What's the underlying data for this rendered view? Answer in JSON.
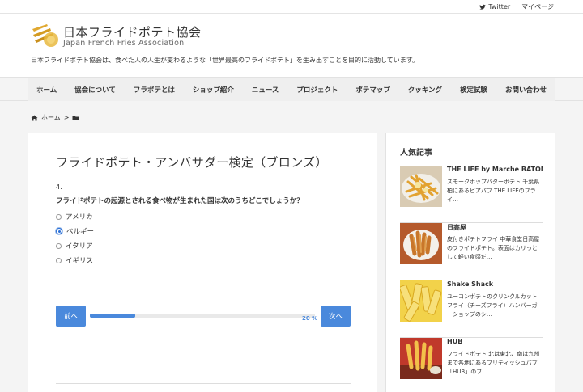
{
  "topbar": {
    "twitter": "Twitter",
    "mypage": "マイページ"
  },
  "header": {
    "logo_title": "日本フライドポテト協会",
    "logo_sub": "Japan French Fries Association",
    "tagline": "日本フライドポテト協会は、食べた人の人生が変わるような「世界最高のフライドポテト」を生み出すことを目的に活動しています。"
  },
  "nav": [
    "ホーム",
    "協会について",
    "フラポテとは",
    "ショップ紹介",
    "ニュース",
    "プロジェクト",
    "ポテマップ",
    "クッキング",
    "検定試験",
    "お問い合わせ"
  ],
  "breadcrumb": {
    "home": "ホーム",
    "separator": ">"
  },
  "quiz": {
    "title": "フライドポテト・アンバサダー検定（ブロンズ）",
    "number": "4.",
    "question": "フライドポテトの起源とされる食べ物が生まれた国は次のうちどこでしょうか？",
    "options": [
      {
        "label": "アメリカ",
        "checked": false
      },
      {
        "label": "ベルギー",
        "checked": true
      },
      {
        "label": "イタリア",
        "checked": false
      },
      {
        "label": "イギリス",
        "checked": false
      }
    ],
    "prev": "前へ",
    "next": "次へ",
    "progress_label": "20 %",
    "progress_fraction": 0.2
  },
  "sidebar": {
    "title": "人気記事",
    "articles": [
      {
        "title": "THE LIFE by Marche BATON",
        "desc": "スモークホップバターポテト 千葉県柏にあるビアパブ THE LIFEのフライ…"
      },
      {
        "title": "日高屋",
        "desc": "皮付きポテトフライ 中華食堂日高屋のフライドポテト。表面はカリっとして軽い食感だ…"
      },
      {
        "title": "Shake Shack",
        "desc": "ユーコンポテトのクリンクルカットフライ（チーズフライ）ハンバーガーショップのシ…"
      },
      {
        "title": "HUB",
        "desc": "フライドポテト 北は東北、南は九州まで各地にあるブリティッシュパブ「HUB」のフ…"
      }
    ]
  },
  "colors": {
    "accent": "#4a89dc"
  }
}
